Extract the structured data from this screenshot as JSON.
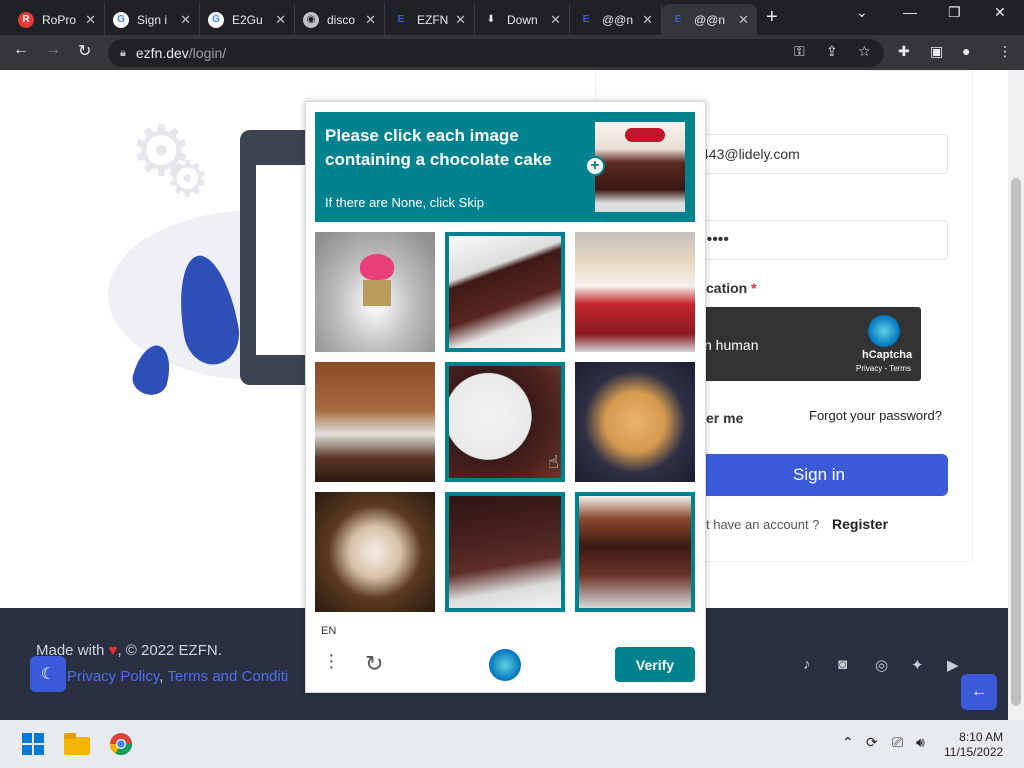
{
  "browser": {
    "tabs": [
      {
        "title": "RoPro",
        "favicon": "ropro-icon",
        "color": "#e53935"
      },
      {
        "title": "Sign i",
        "favicon": "google-icon",
        "color": "#4285f4"
      },
      {
        "title": "E2Gu",
        "favicon": "google-icon",
        "color": "#4285f4"
      },
      {
        "title": "disco",
        "favicon": "globe-icon",
        "color": "#bdc1c6"
      },
      {
        "title": "EZFN",
        "favicon": "ezfn-icon",
        "color": "#3b5bdb"
      },
      {
        "title": "Down",
        "favicon": "download-icon",
        "color": "#e8eaed"
      },
      {
        "title": "@@n",
        "favicon": "ezfn-icon",
        "color": "#3b5bdb"
      },
      {
        "title": "@@n",
        "favicon": "ezfn-icon",
        "color": "#3b5bdb",
        "active": true
      }
    ],
    "url_host": "ezfn.dev",
    "url_path": "/login/"
  },
  "login": {
    "email_value": "443@lidely.com",
    "password_value": "•••••",
    "verification_label": "cation",
    "required_mark": "*",
    "hcaptcha_text": "n human",
    "hcaptcha_brand": "hCaptcha",
    "hcaptcha_links": "Privacy - Terms",
    "remember_label": "er me",
    "forgot_link": "Forgot your password?",
    "signin_label": "Sign in",
    "no_account_text": "t have an account ?",
    "register_link": "Register"
  },
  "footer": {
    "made_with_prefix": "Made with",
    "made_with_suffix": ", © 2022 EZFN.",
    "privacy_link": "Privacy Policy",
    "separator": ",",
    "terms_link": "Terms and Conditi",
    "social": [
      "tiktok-icon",
      "discord-icon",
      "instagram-icon",
      "twitter-icon",
      "youtube-icon"
    ]
  },
  "captcha": {
    "title": "Please click each image containing a chocolate cake",
    "subtitle": "If there are None, click Skip",
    "language": "EN",
    "verify_label": "Verify",
    "accent": "#00838f",
    "grid": [
      {
        "subject": "pink cupcake",
        "selected": false
      },
      {
        "subject": "chocolate cake slice",
        "selected": true
      },
      {
        "subject": "strawberry shortcake",
        "selected": false
      },
      {
        "subject": "coffee dessert",
        "selected": false
      },
      {
        "subject": "chocolate cake slice with fork",
        "selected": true
      },
      {
        "subject": "pancakes",
        "selected": false
      },
      {
        "subject": "cream cupcake",
        "selected": false
      },
      {
        "subject": "chocolate cake",
        "selected": true
      },
      {
        "subject": "layered chocolate cake",
        "selected": true
      }
    ]
  },
  "taskbar": {
    "time": "8:10 AM",
    "date": "11/15/2022"
  }
}
